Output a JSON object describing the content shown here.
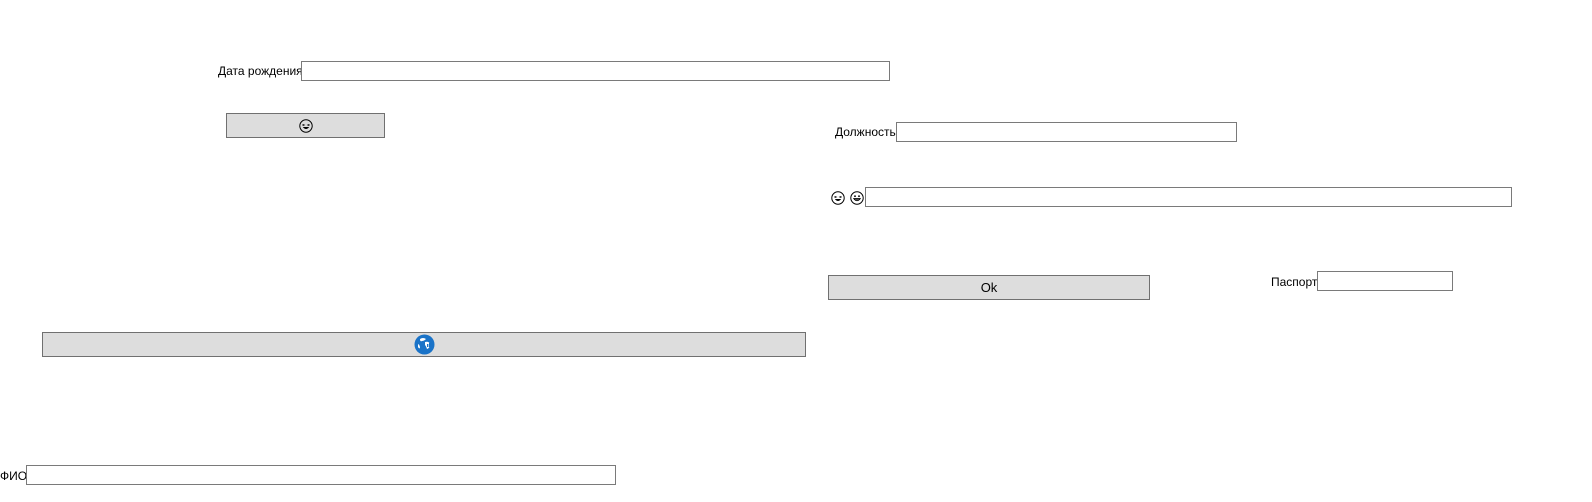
{
  "form": {
    "birth_date": {
      "label": "Дата рождения",
      "value": ""
    },
    "position": {
      "label": "Должность",
      "value": ""
    },
    "emoji_field": {
      "value": ""
    },
    "passport": {
      "label": "Паспорт",
      "value": ""
    },
    "full_name": {
      "label": "ФИО",
      "value": ""
    }
  },
  "buttons": {
    "emoji_button": {
      "icon": "laughing-face-icon"
    },
    "ok_button": {
      "label": "Ok"
    },
    "globe_button": {
      "icon": "globe-icon",
      "accent": "#1a73c8"
    }
  },
  "emoji_labels": [
    {
      "icon": "laughing-face-icon"
    },
    {
      "icon": "grinning-face-icon"
    }
  ]
}
